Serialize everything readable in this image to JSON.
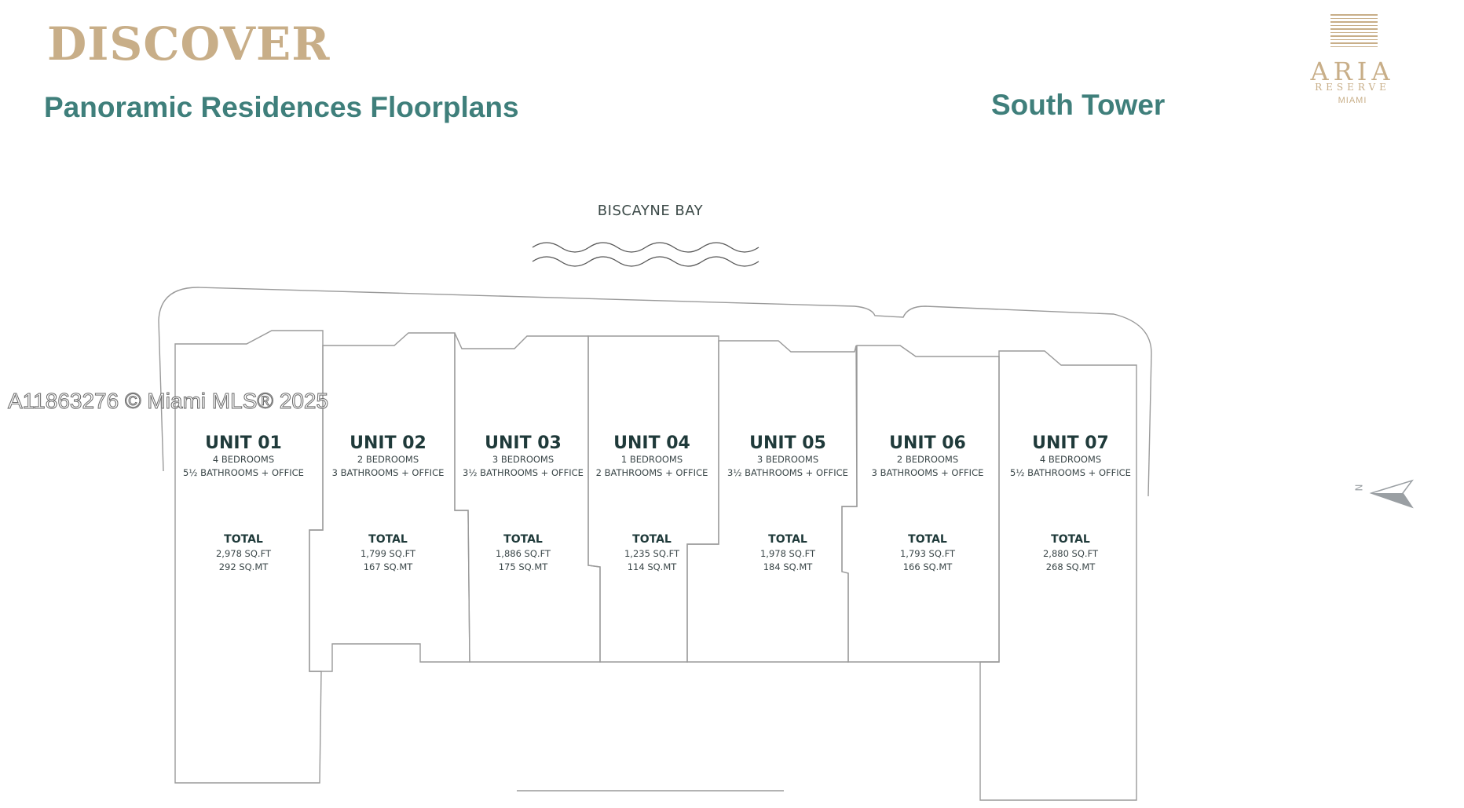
{
  "header": {
    "eyebrow": "DISCOVER",
    "title": "Panoramic Residences Floorplans",
    "tower": "South Tower"
  },
  "logo": {
    "name": "ARIA",
    "line2": "RESERVE",
    "line3": "MIAMI"
  },
  "site": {
    "water_label": "BISCAYNE BAY",
    "compass_label": "N"
  },
  "watermark": "A11863276 © Miami MLS® 2025",
  "colors": {
    "gold": "#c8ae88",
    "teal": "#3f7f7b",
    "outline": "#9a9a9a"
  },
  "units": [
    {
      "name": "UNIT 01",
      "bedrooms": "4 BEDROOMS",
      "bathrooms": "5½ BATHROOMS + OFFICE",
      "total_label": "TOTAL",
      "sqft": "2,978 SQ.FT",
      "sqmt": "292 SQ.MT"
    },
    {
      "name": "UNIT 02",
      "bedrooms": "2 BEDROOMS",
      "bathrooms": "3 BATHROOMS + OFFICE",
      "total_label": "TOTAL",
      "sqft": "1,799 SQ.FT",
      "sqmt": "167 SQ.MT"
    },
    {
      "name": "UNIT 03",
      "bedrooms": "3 BEDROOMS",
      "bathrooms": "3½ BATHROOMS + OFFICE",
      "total_label": "TOTAL",
      "sqft": "1,886 SQ.FT",
      "sqmt": "175 SQ.MT"
    },
    {
      "name": "UNIT 04",
      "bedrooms": "1 BEDROOMS",
      "bathrooms": "2 BATHROOMS + OFFICE",
      "total_label": "TOTAL",
      "sqft": "1,235 SQ.FT",
      "sqmt": "114 SQ.MT"
    },
    {
      "name": "UNIT 05",
      "bedrooms": "3 BEDROOMS",
      "bathrooms": "3½ BATHROOMS  + OFFICE",
      "total_label": "TOTAL",
      "sqft": "1,978 SQ.FT",
      "sqmt": "184 SQ.MT"
    },
    {
      "name": "UNIT 06",
      "bedrooms": "2 BEDROOMS",
      "bathrooms": "3 BATHROOMS + OFFICE",
      "total_label": "TOTAL",
      "sqft": "1,793 SQ.FT",
      "sqmt": "166 SQ.MT"
    },
    {
      "name": "UNIT 07",
      "bedrooms": "4 BEDROOMS",
      "bathrooms": "5½ BATHROOMS + OFFICE",
      "total_label": "TOTAL",
      "sqft": "2,880 SQ.FT",
      "sqmt": "268 SQ.MT"
    }
  ]
}
